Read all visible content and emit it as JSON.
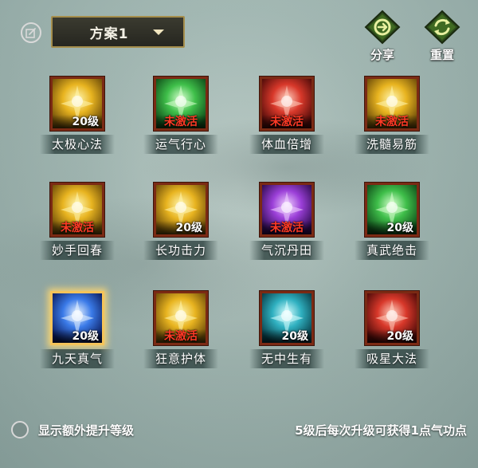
{
  "header": {
    "plan_label": "方案1",
    "share_label": "分享",
    "reset_label": "重置"
  },
  "skills": [
    {
      "name": "太极心法",
      "badge": "20级",
      "status": "level",
      "theme": "gold"
    },
    {
      "name": "运气行心",
      "badge": "未激活",
      "status": "inactive",
      "theme": "green"
    },
    {
      "name": "体血倍增",
      "badge": "未激活",
      "status": "inactive",
      "theme": "red"
    },
    {
      "name": "洗髓易筋",
      "badge": "未激活",
      "status": "inactive",
      "theme": "gold"
    },
    {
      "name": "妙手回春",
      "badge": "未激活",
      "status": "inactive",
      "theme": "gold"
    },
    {
      "name": "长功击力",
      "badge": "20级",
      "status": "level",
      "theme": "gold"
    },
    {
      "name": "气沉丹田",
      "badge": "未激活",
      "status": "inactive",
      "theme": "purple"
    },
    {
      "name": "真武绝击",
      "badge": "20级",
      "status": "level",
      "theme": "green"
    },
    {
      "name": "九天真气",
      "badge": "20级",
      "status": "level",
      "theme": "blue",
      "selected": true
    },
    {
      "name": "狂意护体",
      "badge": "未激活",
      "status": "inactive",
      "theme": "gold"
    },
    {
      "name": "无中生有",
      "badge": "20级",
      "status": "level",
      "theme": "teal"
    },
    {
      "name": "吸星大法",
      "badge": "20级",
      "status": "level",
      "theme": "red"
    }
  ],
  "footer": {
    "toggle_label": "显示额外提升等级",
    "hint": "5级后每次升级可获得1点气功点"
  },
  "colors": {
    "inactive_text": "#ff3a26",
    "frame_border": "#7b2a14",
    "selected_glow": "#f5c45a"
  }
}
